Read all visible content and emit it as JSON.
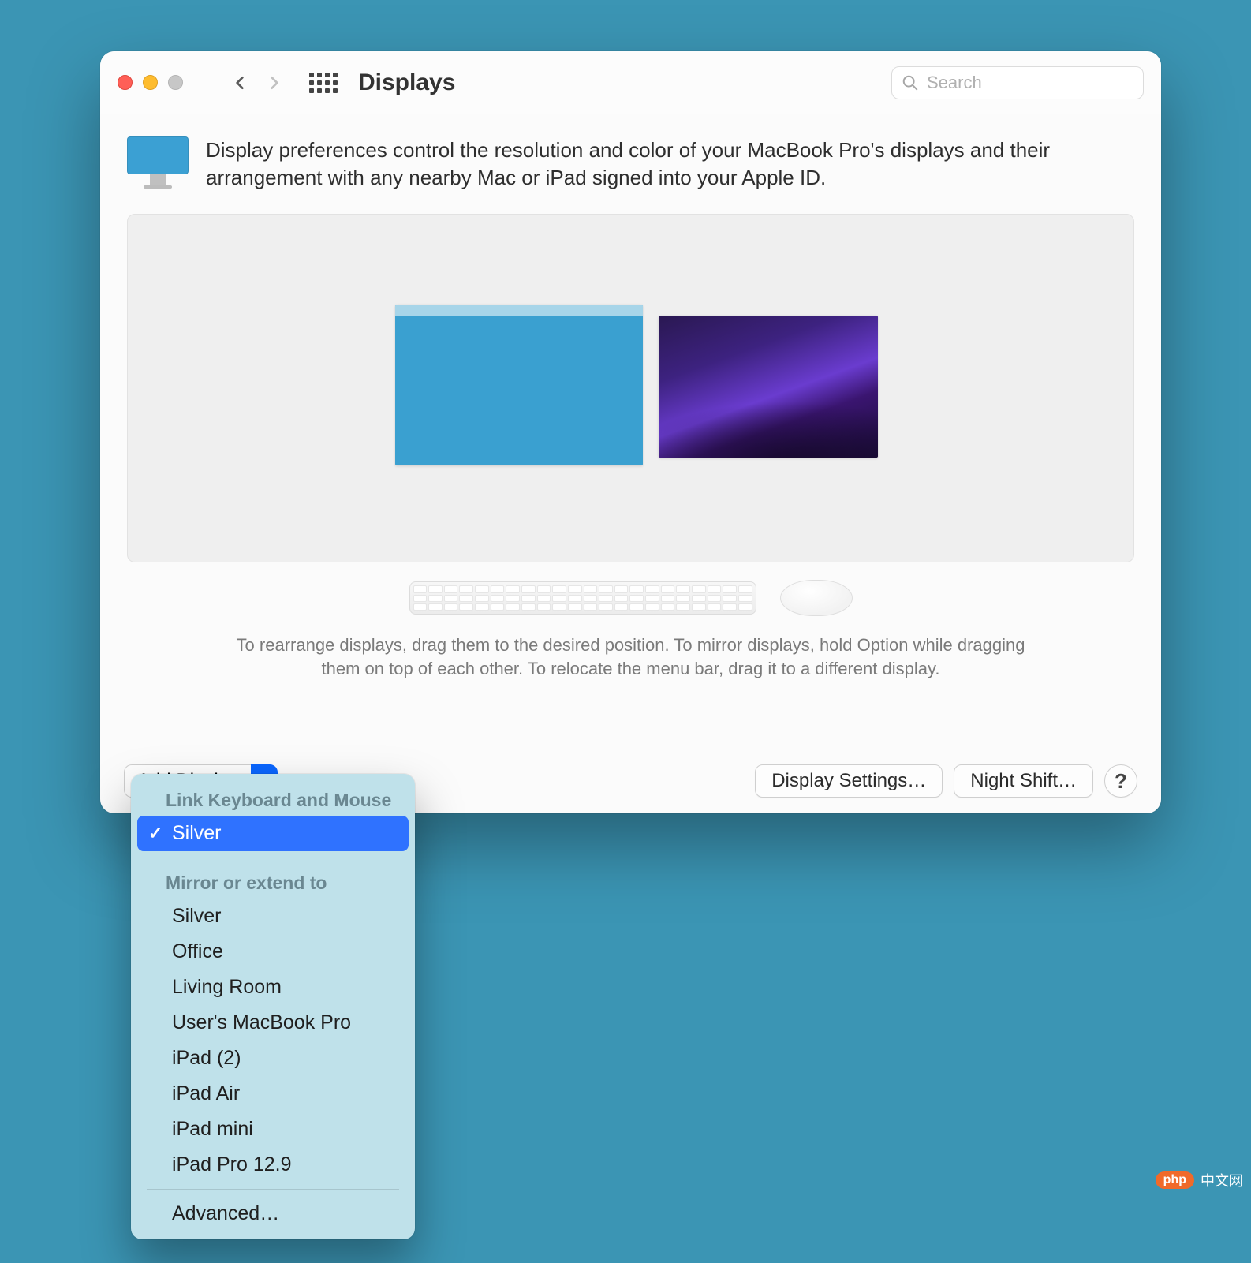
{
  "window": {
    "title": "Displays",
    "search_placeholder": "Search"
  },
  "intro": {
    "text": "Display preferences control the resolution and color of your MacBook Pro's displays and their arrangement with any nearby Mac or iPad signed into your Apple ID."
  },
  "hint": {
    "line1": "To rearrange displays, drag them to the desired position. To mirror displays, hold Option while dragging them on top of each other. To relocate the menu bar, drag it to a different display."
  },
  "footer": {
    "add_display": "Add Display",
    "display_settings": "Display Settings…",
    "night_shift": "Night Shift…",
    "help": "?"
  },
  "dropdown": {
    "section1_title": "Link Keyboard and Mouse",
    "section1_items": [
      "Silver"
    ],
    "section1_selected_index": 0,
    "section2_title": "Mirror or extend to",
    "section2_items": [
      "Silver",
      "Office",
      "Living Room",
      "User's MacBook Pro",
      "iPad (2)",
      "iPad Air",
      "iPad mini",
      "iPad Pro 12.9"
    ],
    "advanced": "Advanced…"
  },
  "watermark": {
    "badge": "php",
    "text": "中文网"
  }
}
